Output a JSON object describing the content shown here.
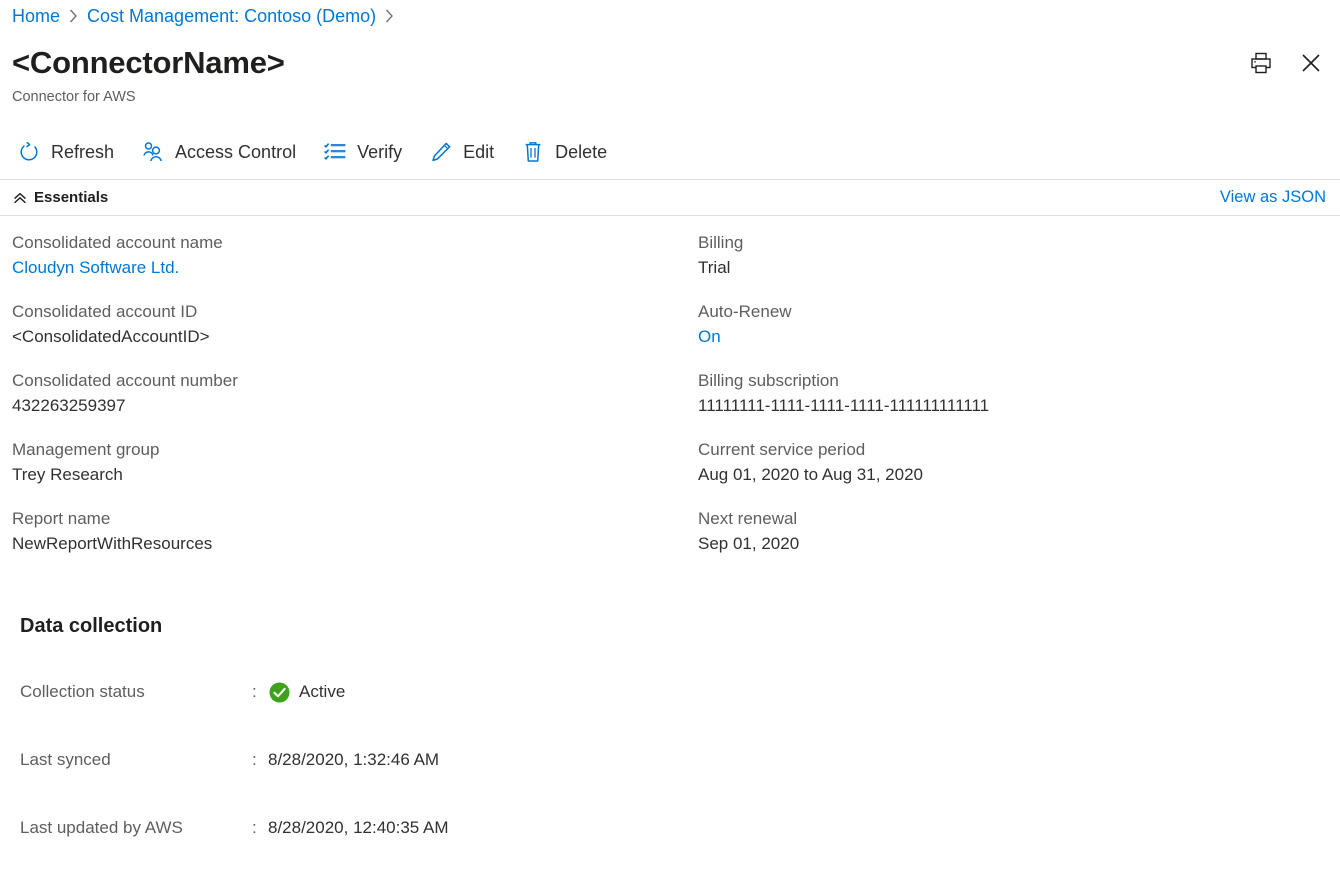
{
  "breadcrumb": {
    "items": [
      {
        "label": "Home"
      },
      {
        "label": "Cost Management: Contoso (Demo)"
      }
    ]
  },
  "header": {
    "title": "<ConnectorName>",
    "subtitle": "Connector for AWS",
    "print_icon": "print-icon",
    "close_icon": "close-icon"
  },
  "commandbar": {
    "items": [
      {
        "label": "Refresh",
        "icon": "refresh-icon"
      },
      {
        "label": "Access Control",
        "icon": "access-control-icon"
      },
      {
        "label": "Verify",
        "icon": "verify-checklist-icon"
      },
      {
        "label": "Edit",
        "icon": "edit-pencil-icon"
      },
      {
        "label": "Delete",
        "icon": "delete-trash-icon"
      }
    ]
  },
  "essentials": {
    "label": "Essentials",
    "collapse_icon": "double-chevron-up-icon",
    "view_as_json": "View as JSON",
    "left": [
      {
        "key": "Consolidated account name",
        "value": "Cloudyn Software Ltd.",
        "is_link": true
      },
      {
        "key": "Consolidated account ID",
        "value": "<ConsolidatedAccountID>",
        "is_link": false
      },
      {
        "key": "Consolidated account number",
        "value": "432263259397",
        "is_link": false
      },
      {
        "key": "Management group",
        "value": "Trey Research",
        "is_link": false
      },
      {
        "key": "Report name",
        "value": "NewReportWithResources",
        "is_link": false
      }
    ],
    "right": [
      {
        "key": "Billing",
        "value": "Trial",
        "is_link": false
      },
      {
        "key": "Auto-Renew",
        "value": "On",
        "is_link": true
      },
      {
        "key": "Billing subscription",
        "value": "11111111-1111-1111-1111-111111111111",
        "is_link": false
      },
      {
        "key": "Current service period",
        "value": "Aug 01, 2020 to Aug 31, 2020",
        "is_link": false
      },
      {
        "key": "Next renewal",
        "value": "Sep 01, 2020",
        "is_link": false
      }
    ]
  },
  "data_collection": {
    "heading": "Data collection",
    "rows": [
      {
        "label": "Collection status",
        "separator": ":",
        "value": "Active",
        "status_icon": "success-check-circle-icon"
      },
      {
        "label": "Last synced",
        "separator": ":",
        "value": "8/28/2020, 1:32:46 AM",
        "status_icon": null
      },
      {
        "label": "Last updated by AWS",
        "separator": ":",
        "value": "8/28/2020, 12:40:35 AM",
        "status_icon": null
      }
    ]
  },
  "colors": {
    "link": "#0078d4",
    "accent": "#0078d4",
    "success_green": "#3fa21c",
    "text_primary": "#323130",
    "text_secondary": "#605e5c",
    "divider": "#e1dfdd"
  }
}
